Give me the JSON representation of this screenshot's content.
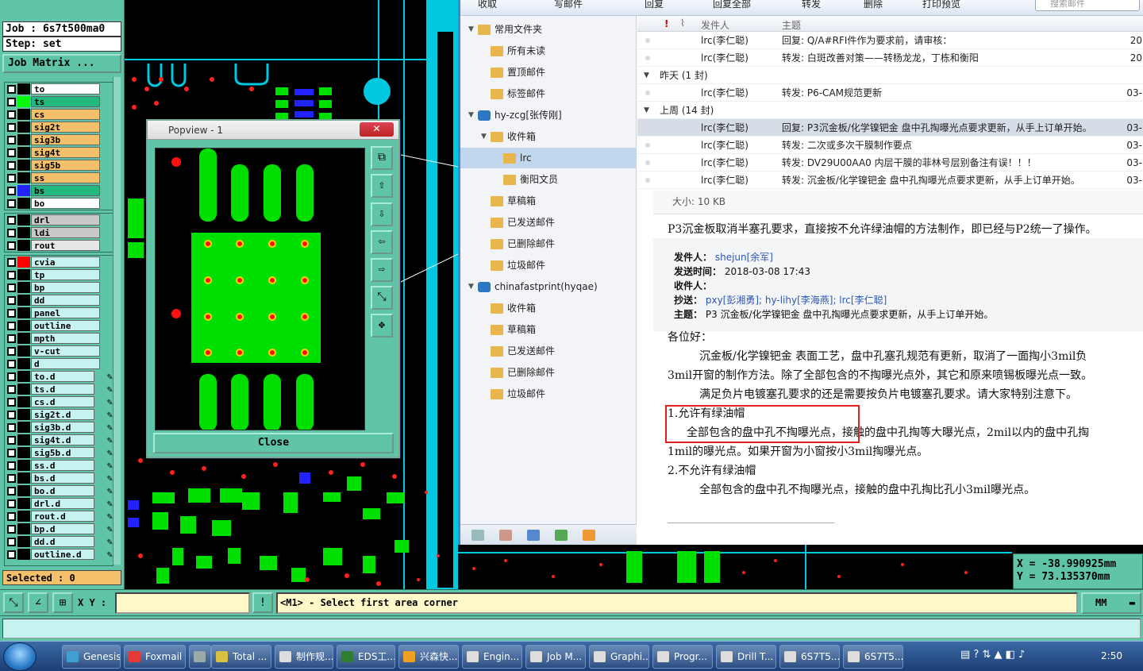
{
  "genesis": {
    "job_label": "Job : 6s7t500ma0",
    "step_label": "Step: set",
    "job_matrix_label": "Job Matrix ...",
    "selected_label": "Selected : 0",
    "layers": [
      {
        "name": "to",
        "color": "#ffffff",
        "highlight": "#000000"
      },
      {
        "name": "ts",
        "color": "#22b880",
        "highlight": "#00ff00"
      },
      {
        "name": "cs",
        "color": "#f4c06a",
        "highlight": "#000000"
      },
      {
        "name": "sig2t",
        "color": "#f4c06a",
        "highlight": "#000000"
      },
      {
        "name": "sig3b",
        "color": "#f4c06a",
        "highlight": "#000000"
      },
      {
        "name": "sig4t",
        "color": "#f4c06a",
        "highlight": "#000000"
      },
      {
        "name": "sig5b",
        "color": "#f4c06a",
        "highlight": "#000000"
      },
      {
        "name": "ss",
        "color": "#f4c06a",
        "highlight": "#000000"
      },
      {
        "name": "bs",
        "color": "#22b880",
        "highlight": "#2222ff"
      },
      {
        "name": "bo",
        "color": "#ffffff",
        "highlight": "#000000"
      }
    ],
    "drill_layers": [
      {
        "name": "drl",
        "color": "#c8c8c8"
      },
      {
        "name": "ldi",
        "color": "#c8c8c8"
      },
      {
        "name": "rout",
        "color": "#e6e6e6"
      }
    ],
    "other_layers": [
      {
        "name": "cvia",
        "highlight": "#ff0000"
      },
      {
        "name": "tp"
      },
      {
        "name": "bp"
      },
      {
        "name": "dd"
      },
      {
        "name": "panel"
      },
      {
        "name": "outline"
      },
      {
        "name": "mpth"
      },
      {
        "name": "v-cut"
      },
      {
        "name": "d"
      },
      {
        "name": "to.d",
        "pen": true
      },
      {
        "name": "ts.d",
        "pen": true
      },
      {
        "name": "cs.d",
        "pen": true
      },
      {
        "name": "sig2t.d",
        "pen": true
      },
      {
        "name": "sig3b.d",
        "pen": true
      },
      {
        "name": "sig4t.d",
        "pen": true
      },
      {
        "name": "sig5b.d",
        "pen": true
      },
      {
        "name": "ss.d",
        "pen": true
      },
      {
        "name": "bs.d",
        "pen": true
      },
      {
        "name": "bo.d",
        "pen": true
      },
      {
        "name": "drl.d",
        "pen": true
      },
      {
        "name": "rout.d",
        "pen": true
      },
      {
        "name": "bp.d",
        "pen": true
      },
      {
        "name": "dd.d",
        "pen": true
      },
      {
        "name": "outline.d",
        "pen": true
      }
    ],
    "coord_x": "X = -38.990925mm",
    "coord_y": "Y =  73.135370mm",
    "xy_label": "X Y :",
    "message": "<M1> - Select first area corner",
    "units": "MM"
  },
  "popview": {
    "title": "Popview - 1",
    "close_label": "Close"
  },
  "foxmail": {
    "toolbar": {
      "collect": "收取",
      "compose": "写邮件",
      "reply": "回复",
      "reply_all": "回复全部",
      "forward": "转发",
      "delete": "删除",
      "print": "打印预览",
      "search_placeholder": "搜索邮件"
    },
    "folders": [
      {
        "label": "常用文件夹",
        "level": 0,
        "arrow": true
      },
      {
        "label": "所有未读",
        "level": 1
      },
      {
        "label": "置顶邮件",
        "level": 1
      },
      {
        "label": "标签邮件",
        "level": 1
      },
      {
        "label": "hy-zcg[张传刚]",
        "level": 0,
        "arrow": true,
        "account": true
      },
      {
        "label": "收件箱",
        "level": 1,
        "arrow": true
      },
      {
        "label": "lrc",
        "level": 2,
        "selected": true
      },
      {
        "label": "衡阳文员",
        "level": 2
      },
      {
        "label": "草稿箱",
        "level": 1
      },
      {
        "label": "已发送邮件",
        "level": 1
      },
      {
        "label": "已删除邮件",
        "level": 1
      },
      {
        "label": "垃圾邮件",
        "level": 1
      },
      {
        "label": "chinafastprint(hyqae)",
        "level": 0,
        "arrow": true,
        "account": true
      },
      {
        "label": "收件箱",
        "level": 1
      },
      {
        "label": "草稿箱",
        "level": 1
      },
      {
        "label": "已发送邮件",
        "level": 1
      },
      {
        "label": "已删除邮件",
        "level": 1
      },
      {
        "label": "垃圾邮件",
        "level": 1
      }
    ],
    "list_header": {
      "from": "发件人",
      "subject": "主题"
    },
    "rows_top": [
      {
        "from": "lrc(李仁聪)",
        "subject": "回复: Q/A#RFI件作为要求前，请审核：",
        "date": "20"
      },
      {
        "from": "lrc(李仁聪)",
        "subject": "转发: 白斑改善对策——转杨龙龙，丁栋和衡阳",
        "date": "20"
      }
    ],
    "group_yesterday": "昨天 (1 封)",
    "rows_yesterday": [
      {
        "from": "lrc(李仁聪)",
        "subject": "转发: P6-CAM规范更新",
        "date": "03-"
      }
    ],
    "group_lastweek": "上周 (14 封)",
    "rows_lastweek": [
      {
        "from": "lrc(李仁聪)",
        "subject": "回复: P3沉金板/化学镍钯金 盘中孔掏曝光点要求更新，从手上订单开始。",
        "date": "03-",
        "selected": true
      },
      {
        "from": "lrc(李仁聪)",
        "subject": "转发: 二次或多次干膜制作要点",
        "date": "03-"
      },
      {
        "from": "lrc(李仁聪)",
        "subject": "转发: DV29U00AA0  内层干膜的菲林号层别备注有误！！！",
        "date": "03-"
      },
      {
        "from": "lrc(李仁聪)",
        "subject": "转发: 沉金板/化学镍钯金 盘中孔掏曝光点要求更新，从手上订单开始。",
        "date": "03-"
      }
    ],
    "body": {
      "size": "大小: 10 KB",
      "intro": "P3沉金板取消半塞孔要求，直接按不允许绿油帽的方法制作，即已经与P2统一了操作。",
      "sender_label": "发件人：",
      "sender": "shejun[余军]",
      "sent_label": "发送时间：",
      "sent": "2018-03-08 17:43",
      "to_label": "收件人：",
      "cc_label": "抄送：",
      "cc": "pxy[彭湘勇]; hy-lihy[李海燕]; lrc[李仁聪]",
      "subject_label": "主题：",
      "subject": "P3 沉金板/化学镍钯金 盘中孔掏曝光点要求更新，从手上订单开始。",
      "greeting": "各位好：",
      "p1a": "沉金板/化学镍钯金 表面工艺，盘中孔塞孔规范有更新，取消了一面掏小3mil负",
      "p1b": "3mil开窗的制作方法。除了全部包含的不掏曝光点外，其它和原来喷锡板曝光点一致。",
      "p2": "满足负片电镀塞孔要求的还是需要按负片电镀塞孔要求。请大家特别注意下。",
      "item1": "1.允许有绿油帽",
      "item1a": "全部包含的盘中孔不掏曝光点，接触的盘中孔掏等大曝光点，2mil以内的盘中孔掏",
      "item1b": "1mil的曝光点。如果开窗为小窗按小3mil掏曝光点。",
      "item2": "2.不允许有绿油帽",
      "item2a": "全部包含的盘中孔不掏曝光点，接触的盘中孔掏比孔小3mil曝光点。"
    }
  },
  "taskbar": {
    "items": [
      {
        "label": "Genesis",
        "color": "#3fa0d0"
      },
      {
        "label": "Foxmail",
        "color": "#e53935"
      },
      {
        "label": "",
        "color": "#9aa"
      },
      {
        "label": "Total ...",
        "color": "#d8c040"
      },
      {
        "label": "制作规...",
        "color": "#ddd"
      },
      {
        "label": "EDS工...",
        "color": "#2e7d32"
      },
      {
        "label": "兴森快...",
        "color": "#f0a020"
      },
      {
        "label": "Engin...",
        "color": "#ddd"
      },
      {
        "label": "Job M...",
        "color": "#ddd"
      },
      {
        "label": "Graphi...",
        "color": "#ddd"
      },
      {
        "label": "Progr...",
        "color": "#ddd"
      },
      {
        "label": "Drill T...",
        "color": "#ddd"
      },
      {
        "label": "6S7T5...",
        "color": "#ddd"
      },
      {
        "label": "6S7T5...",
        "color": "#ddd"
      }
    ],
    "clock": "2:50"
  }
}
